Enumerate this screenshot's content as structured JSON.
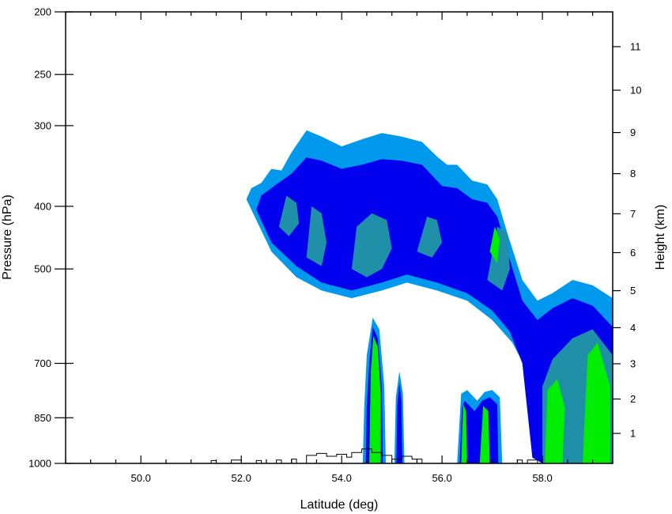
{
  "chart_data": {
    "type": "contour",
    "title": "",
    "xlabel": "Latitude (deg)",
    "ylabel_left": "Pressure (hPa)",
    "ylabel_right": "Height (km)",
    "xlim": [
      48.5,
      59.4
    ],
    "ylim_pressure": [
      1000,
      200
    ],
    "pressure_scale": "log",
    "x_ticks": [
      {
        "value": 50.0,
        "label": "50.0"
      },
      {
        "value": 52.0,
        "label": "52.0"
      },
      {
        "value": 54.0,
        "label": "54.0"
      },
      {
        "value": 56.0,
        "label": "56.0"
      },
      {
        "value": 58.0,
        "label": "58.0"
      }
    ],
    "x_minor_step": 0.5,
    "pressure_ticks": [
      {
        "value": 200,
        "label": "200"
      },
      {
        "value": 250,
        "label": "250"
      },
      {
        "value": 300,
        "label": "300"
      },
      {
        "value": 400,
        "label": "400"
      },
      {
        "value": 500,
        "label": "500"
      },
      {
        "value": 700,
        "label": "700"
      },
      {
        "value": 850,
        "label": "850"
      },
      {
        "value": 1000,
        "label": "1000"
      }
    ],
    "height_ticks": [
      {
        "value": 1,
        "label": "1"
      },
      {
        "value": 2,
        "label": "2"
      },
      {
        "value": 3,
        "label": "3"
      },
      {
        "value": 4,
        "label": "4"
      },
      {
        "value": 5,
        "label": "5"
      },
      {
        "value": 6,
        "label": "6"
      },
      {
        "value": 7,
        "label": "7"
      },
      {
        "value": 8,
        "label": "8"
      },
      {
        "value": 9,
        "label": "9"
      },
      {
        "value": 10,
        "label": "10"
      },
      {
        "value": 11,
        "label": "11"
      }
    ],
    "contour_colors": [
      "#0099ee",
      "#0000ee",
      "#2090a8",
      "#00ee00"
    ],
    "grid": false,
    "legend": "none",
    "regions": [
      {
        "level": 0,
        "name": "upper-cloud-outer",
        "points": [
          [
            52.1,
            390
          ],
          [
            52.3,
            420
          ],
          [
            52.6,
            470
          ],
          [
            53.1,
            515
          ],
          [
            53.6,
            540
          ],
          [
            54.2,
            555
          ],
          [
            54.8,
            540
          ],
          [
            55.3,
            525
          ],
          [
            55.9,
            540
          ],
          [
            56.5,
            560
          ],
          [
            57.0,
            600
          ],
          [
            57.4,
            650
          ],
          [
            57.7,
            720
          ],
          [
            57.9,
            980
          ],
          [
            58.1,
            1000
          ],
          [
            59.4,
            1000
          ],
          [
            59.4,
            555
          ],
          [
            59.0,
            530
          ],
          [
            58.6,
            520
          ],
          [
            58.2,
            545
          ],
          [
            57.9,
            560
          ],
          [
            57.6,
            520
          ],
          [
            57.3,
            440
          ],
          [
            57.1,
            390
          ],
          [
            56.9,
            370
          ],
          [
            56.6,
            365
          ],
          [
            56.3,
            345
          ],
          [
            56.1,
            345
          ],
          [
            55.9,
            335
          ],
          [
            55.6,
            318
          ],
          [
            55.2,
            312
          ],
          [
            54.8,
            308
          ],
          [
            54.4,
            315
          ],
          [
            54.0,
            323
          ],
          [
            53.6,
            312
          ],
          [
            53.3,
            305
          ],
          [
            53.0,
            330
          ],
          [
            52.8,
            352
          ],
          [
            52.6,
            350
          ],
          [
            52.4,
            368
          ],
          [
            52.2,
            375
          ]
        ]
      },
      {
        "level": 1,
        "name": "upper-cloud-inner",
        "points": [
          [
            52.3,
            405
          ],
          [
            52.6,
            455
          ],
          [
            53.1,
            495
          ],
          [
            53.6,
            525
          ],
          [
            54.2,
            540
          ],
          [
            54.8,
            525
          ],
          [
            55.3,
            510
          ],
          [
            55.9,
            525
          ],
          [
            56.5,
            545
          ],
          [
            57.0,
            580
          ],
          [
            57.35,
            625
          ],
          [
            57.6,
            700
          ],
          [
            57.8,
            980
          ],
          [
            58.0,
            1000
          ],
          [
            59.4,
            1000
          ],
          [
            59.4,
            615
          ],
          [
            59.0,
            570
          ],
          [
            58.6,
            555
          ],
          [
            58.2,
            575
          ],
          [
            57.9,
            600
          ],
          [
            57.6,
            560
          ],
          [
            57.3,
            470
          ],
          [
            57.1,
            415
          ],
          [
            56.9,
            395
          ],
          [
            56.6,
            390
          ],
          [
            56.3,
            375
          ],
          [
            56.0,
            372
          ],
          [
            55.6,
            345
          ],
          [
            55.2,
            340
          ],
          [
            54.8,
            338
          ],
          [
            54.4,
            345
          ],
          [
            54.0,
            350
          ],
          [
            53.6,
            340
          ],
          [
            53.3,
            336
          ],
          [
            53.0,
            356
          ],
          [
            52.7,
            370
          ],
          [
            52.4,
            385
          ]
        ]
      },
      {
        "level": 2,
        "name": "upper-core-a",
        "points": [
          [
            52.75,
            430
          ],
          [
            52.95,
            445
          ],
          [
            53.15,
            425
          ],
          [
            53.1,
            395
          ],
          [
            52.9,
            385
          ]
        ]
      },
      {
        "level": 2,
        "name": "upper-core-b",
        "points": [
          [
            53.3,
            480
          ],
          [
            53.6,
            495
          ],
          [
            53.7,
            455
          ],
          [
            53.6,
            410
          ],
          [
            53.4,
            400
          ]
        ]
      },
      {
        "level": 2,
        "name": "upper-core-c",
        "points": [
          [
            54.2,
            500
          ],
          [
            54.5,
            515
          ],
          [
            54.8,
            500
          ],
          [
            55.0,
            465
          ],
          [
            54.9,
            420
          ],
          [
            54.6,
            410
          ],
          [
            54.3,
            430
          ]
        ]
      },
      {
        "level": 2,
        "name": "upper-core-d",
        "points": [
          [
            55.5,
            470
          ],
          [
            55.8,
            480
          ],
          [
            56.0,
            455
          ],
          [
            55.9,
            420
          ],
          [
            55.7,
            415
          ]
        ]
      },
      {
        "level": 2,
        "name": "upper-core-e",
        "points": [
          [
            56.9,
            520
          ],
          [
            57.2,
            540
          ],
          [
            57.35,
            500
          ],
          [
            57.3,
            440
          ],
          [
            57.1,
            430
          ]
        ]
      },
      {
        "level": 2,
        "name": "lower-right-core",
        "points": [
          [
            58.0,
            1000
          ],
          [
            59.4,
            1000
          ],
          [
            59.4,
            680
          ],
          [
            59.0,
            620
          ],
          [
            58.6,
            640
          ],
          [
            58.2,
            690
          ],
          [
            58.0,
            760
          ]
        ]
      },
      {
        "level": 3,
        "name": "lower-right-green-a",
        "points": [
          [
            58.05,
            1000
          ],
          [
            58.4,
            1000
          ],
          [
            58.45,
            820
          ],
          [
            58.3,
            740
          ],
          [
            58.1,
            770
          ]
        ]
      },
      {
        "level": 3,
        "name": "lower-right-green-b",
        "points": [
          [
            58.8,
            1000
          ],
          [
            59.35,
            1000
          ],
          [
            59.35,
            760
          ],
          [
            59.1,
            650
          ],
          [
            58.9,
            680
          ]
        ]
      },
      {
        "level": 3,
        "name": "upper-green-strip",
        "points": [
          [
            56.95,
            470
          ],
          [
            57.1,
            490
          ],
          [
            57.15,
            450
          ],
          [
            57.05,
            430
          ]
        ]
      },
      {
        "level": 0,
        "name": "convective-tower-1",
        "points": [
          [
            54.42,
            1000
          ],
          [
            54.88,
            1000
          ],
          [
            54.85,
            760
          ],
          [
            54.75,
            620
          ],
          [
            54.62,
            595
          ],
          [
            54.5,
            680
          ],
          [
            54.45,
            820
          ]
        ]
      },
      {
        "level": 1,
        "name": "convective-tower-1-inner",
        "points": [
          [
            54.48,
            1000
          ],
          [
            54.82,
            1000
          ],
          [
            54.8,
            760
          ],
          [
            54.72,
            640
          ],
          [
            54.62,
            615
          ],
          [
            54.55,
            700
          ],
          [
            54.5,
            820
          ]
        ]
      },
      {
        "level": 3,
        "name": "convective-tower-1-core",
        "points": [
          [
            54.55,
            1000
          ],
          [
            54.78,
            1000
          ],
          [
            54.78,
            780
          ],
          [
            54.72,
            660
          ],
          [
            54.63,
            635
          ],
          [
            54.58,
            720
          ]
        ]
      },
      {
        "level": 0,
        "name": "convective-tower-2",
        "points": [
          [
            55.05,
            1000
          ],
          [
            55.25,
            1000
          ],
          [
            55.22,
            780
          ],
          [
            55.15,
            720
          ],
          [
            55.08,
            790
          ]
        ]
      },
      {
        "level": 1,
        "name": "convective-tower-2-inner",
        "points": [
          [
            55.09,
            1000
          ],
          [
            55.21,
            1000
          ],
          [
            55.19,
            800
          ],
          [
            55.15,
            750
          ],
          [
            55.11,
            810
          ]
        ]
      },
      {
        "level": 0,
        "name": "convective-cluster-3",
        "points": [
          [
            56.3,
            1000
          ],
          [
            57.2,
            1000
          ],
          [
            57.15,
            790
          ],
          [
            57.0,
            770
          ],
          [
            56.85,
            775
          ],
          [
            56.7,
            800
          ],
          [
            56.5,
            770
          ],
          [
            56.38,
            780
          ]
        ]
      },
      {
        "level": 1,
        "name": "convective-cluster-3-inner",
        "points": [
          [
            56.35,
            1000
          ],
          [
            57.12,
            1000
          ],
          [
            57.1,
            810
          ],
          [
            56.95,
            790
          ],
          [
            56.8,
            800
          ],
          [
            56.65,
            830
          ],
          [
            56.45,
            800
          ],
          [
            56.4,
            820
          ]
        ]
      },
      {
        "level": 3,
        "name": "convective-cluster-3-green-a",
        "points": [
          [
            56.38,
            1000
          ],
          [
            56.5,
            1000
          ],
          [
            56.48,
            830
          ],
          [
            56.42,
            810
          ]
        ]
      },
      {
        "level": 3,
        "name": "convective-cluster-3-green-b",
        "points": [
          [
            56.75,
            1000
          ],
          [
            56.95,
            1000
          ],
          [
            56.92,
            830
          ],
          [
            56.82,
            815
          ]
        ]
      }
    ],
    "terrain": [
      [
        51.4,
        1000
      ],
      [
        51.4,
        990
      ],
      [
        51.5,
        990
      ],
      [
        51.5,
        1000
      ],
      [
        51.8,
        1000
      ],
      [
        51.8,
        988
      ],
      [
        52.0,
        988
      ],
      [
        52.0,
        1000
      ],
      [
        52.3,
        1000
      ],
      [
        52.3,
        990
      ],
      [
        52.4,
        990
      ],
      [
        52.4,
        1000
      ],
      [
        52.7,
        1000
      ],
      [
        52.7,
        988
      ],
      [
        52.8,
        988
      ],
      [
        52.8,
        1000
      ],
      [
        53.0,
        1000
      ],
      [
        53.0,
        985
      ],
      [
        53.1,
        985
      ],
      [
        53.1,
        1000
      ],
      [
        53.3,
        1000
      ],
      [
        53.3,
        972
      ],
      [
        53.5,
        972
      ],
      [
        53.5,
        965
      ],
      [
        53.7,
        965
      ],
      [
        53.7,
        975
      ],
      [
        53.9,
        975
      ],
      [
        53.9,
        968
      ],
      [
        54.1,
        968
      ],
      [
        54.1,
        978
      ],
      [
        54.2,
        978
      ],
      [
        54.2,
        962
      ],
      [
        54.4,
        962
      ],
      [
        54.4,
        950
      ],
      [
        54.6,
        950
      ],
      [
        54.6,
        962
      ],
      [
        54.8,
        962
      ],
      [
        54.8,
        972
      ],
      [
        55.0,
        972
      ],
      [
        55.0,
        985
      ],
      [
        55.2,
        985
      ],
      [
        55.2,
        975
      ],
      [
        55.4,
        975
      ],
      [
        55.4,
        985
      ],
      [
        55.6,
        985
      ],
      [
        55.6,
        1000
      ],
      [
        57.5,
        1000
      ],
      [
        57.5,
        988
      ],
      [
        57.6,
        988
      ],
      [
        57.6,
        1000
      ],
      [
        57.7,
        1000
      ],
      [
        57.7,
        988
      ],
      [
        57.9,
        988
      ],
      [
        57.9,
        1000
      ]
    ]
  }
}
